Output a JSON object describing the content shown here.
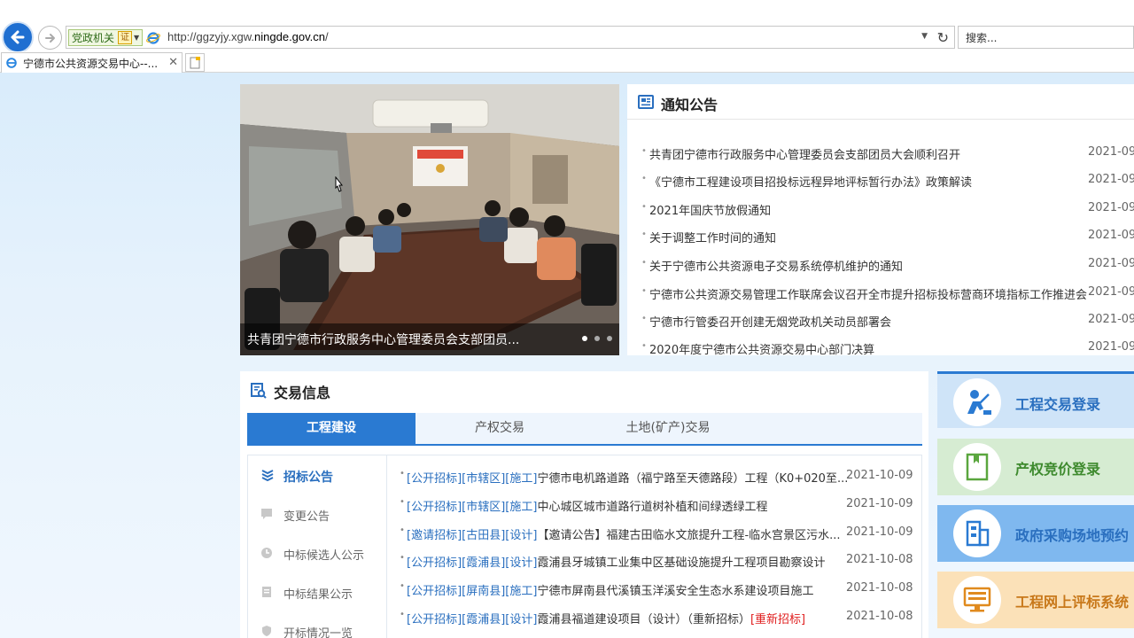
{
  "browser": {
    "party_badge": "党政机关",
    "cert_glyph": "证",
    "url_prefix": "http://ggzyjy.xgw.",
    "url_domain": "ningde.gov.cn",
    "url_suffix": "/",
    "search_placeholder": "搜索...",
    "tab_title": "宁德市公共资源交易中心--...",
    "tab_close": "✕"
  },
  "carousel": {
    "caption": "共青团宁德市行政服务中心管理委员会支部团员..."
  },
  "notice": {
    "title": "通知公告",
    "items": [
      {
        "text": "共青团宁德市行政服务中心管理委员会支部团员大会顺利召开",
        "date": "2021-09-"
      },
      {
        "text": "《宁德市工程建设项目招投标远程异地评标暂行办法》政策解读",
        "date": "2021-09-"
      },
      {
        "text": "2021年国庆节放假通知",
        "date": "2021-09-"
      },
      {
        "text": "关于调整工作时间的通知",
        "date": "2021-09-"
      },
      {
        "text": "关于宁德市公共资源电子交易系统停机维护的通知",
        "date": "2021-09-"
      },
      {
        "text": "宁德市公共资源交易管理工作联席会议召开全市提升招标投标营商环境指标工作推进会",
        "date": "2021-09-"
      },
      {
        "text": "宁德市行管委召开创建无烟党政机关动员部署会",
        "date": "2021-09-"
      },
      {
        "text": "2020年度宁德市公共资源交易中心部门决算",
        "date": "2021-09-"
      }
    ]
  },
  "trade": {
    "title": "交易信息",
    "tabs": [
      "工程建设",
      "产权交易",
      "土地(矿产)交易"
    ],
    "side_menu": [
      "招标公告",
      "变更公告",
      "中标候选人公示",
      "中标结果公示",
      "开标情况一览"
    ],
    "rows": [
      {
        "tags": "[公开招标][市辖区][施工]",
        "title": "宁德市电机路道路（福宁路至天德路段）工程（K0+020至...",
        "extra": "",
        "date": "2021-10-09"
      },
      {
        "tags": "[公开招标][市辖区][施工]",
        "title": "中心城区城市道路行道树补植和间绿透绿工程",
        "extra": "",
        "date": "2021-10-09"
      },
      {
        "tags": "[邀请招标][古田县][设计]",
        "title": "【邀请公告】福建古田临水文旅提升工程-临水宫景区污水...",
        "extra": "",
        "date": "2021-10-09"
      },
      {
        "tags": "[公开招标][霞浦县][设计]",
        "title": "霞浦县牙城镇工业集中区基础设施提升工程项目勘察设计",
        "extra": "",
        "date": "2021-10-08"
      },
      {
        "tags": "[公开招标][屏南县][施工]",
        "title": "宁德市屏南县代溪镇玉洋溪安全生态水系建设项目施工",
        "extra": "",
        "date": "2021-10-08"
      },
      {
        "tags": "[公开招标][霞浦县][设计]",
        "title": "霞浦县福道建设项目（设计）（重新招标）",
        "extra": "[重新招标]",
        "date": "2021-10-08"
      }
    ]
  },
  "quick_links": [
    {
      "label": "工程交易登录",
      "bg": "#cfe4f8",
      "color": "#2a6fbf",
      "icon": "worker-icon"
    },
    {
      "label": "产权竞价登录",
      "bg": "#d6ecd2",
      "color": "#3e8a2e",
      "icon": "book-icon"
    },
    {
      "label": "政府采购场地预约",
      "bg": "#7fb8ef",
      "color": "#2a6fbf",
      "icon": "building-icon"
    },
    {
      "label": "工程网上评标系统",
      "bg": "#fbe1b8",
      "color": "#c8781a",
      "icon": "monitor-icon"
    }
  ]
}
